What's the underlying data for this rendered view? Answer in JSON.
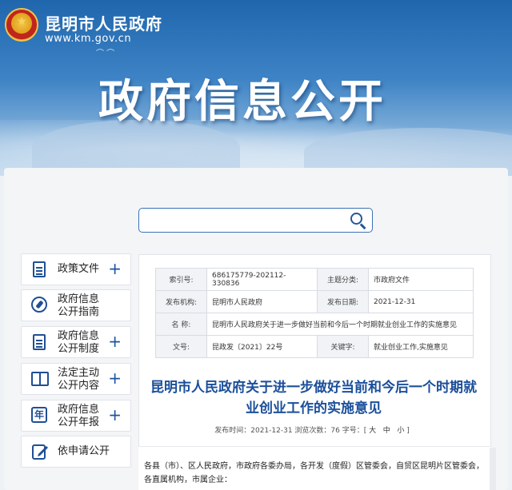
{
  "header": {
    "site_name": "昆明市人民政府",
    "site_url": "www.km.gov.cn",
    "section_title": "政府信息公开"
  },
  "search": {
    "placeholder": ""
  },
  "sidebar": {
    "items": [
      {
        "label_line1": "政策文件",
        "label_line2": "",
        "icon": "document-icon",
        "expandable": true
      },
      {
        "label_line1": "政府信息",
        "label_line2": "公开指南",
        "icon": "compass-icon",
        "expandable": false
      },
      {
        "label_line1": "政府信息",
        "label_line2": "公开制度",
        "icon": "document-icon",
        "expandable": true
      },
      {
        "label_line1": "法定主动",
        "label_line2": "公开内容",
        "icon": "book-icon",
        "expandable": true
      },
      {
        "label_line1": "政府信息",
        "label_line2": "公开年报",
        "icon": "year-icon",
        "expandable": true
      },
      {
        "label_line1": "依申请公开",
        "label_line2": "",
        "icon": "edit-icon",
        "expandable": false
      }
    ],
    "expand_symbol": "+"
  },
  "meta": {
    "index_label": "索引号:",
    "index_value": "686175779-202112-330836",
    "topic_label": "主题分类:",
    "topic_value": "市政府文件",
    "issuer_label": "发布机构:",
    "issuer_value": "昆明市人民政府",
    "date_label": "发布日期:",
    "date_value": "2021-12-31",
    "name_label": "名 称:",
    "name_value": "昆明市人民政府关于进一步做好当前和今后一个时期就业创业工作的实施意见",
    "docno_label": "文号:",
    "docno_value": "昆政发〔2021〕22号",
    "keyword_label": "关键字:",
    "keyword_value": "就业创业工作,实施意见"
  },
  "document": {
    "title": "昆明市人民政府关于进一步做好当前和今后一个时期就业创业工作的实施意见",
    "info_prefix": "发布时间：2021-12-31  浏览次数：76  字号：[",
    "size_large": "大",
    "size_medium": "中",
    "size_small": "小",
    "info_suffix": "]",
    "body": "各县（市）、区人民政府，市政府各委办局，各开发（度假）区管委会，自贸区昆明片区管委会，各直属机构，市属企业："
  },
  "colors": {
    "accent": "#1b4f9a",
    "banner_top": "#1f66ad",
    "border": "#3a72b8"
  }
}
